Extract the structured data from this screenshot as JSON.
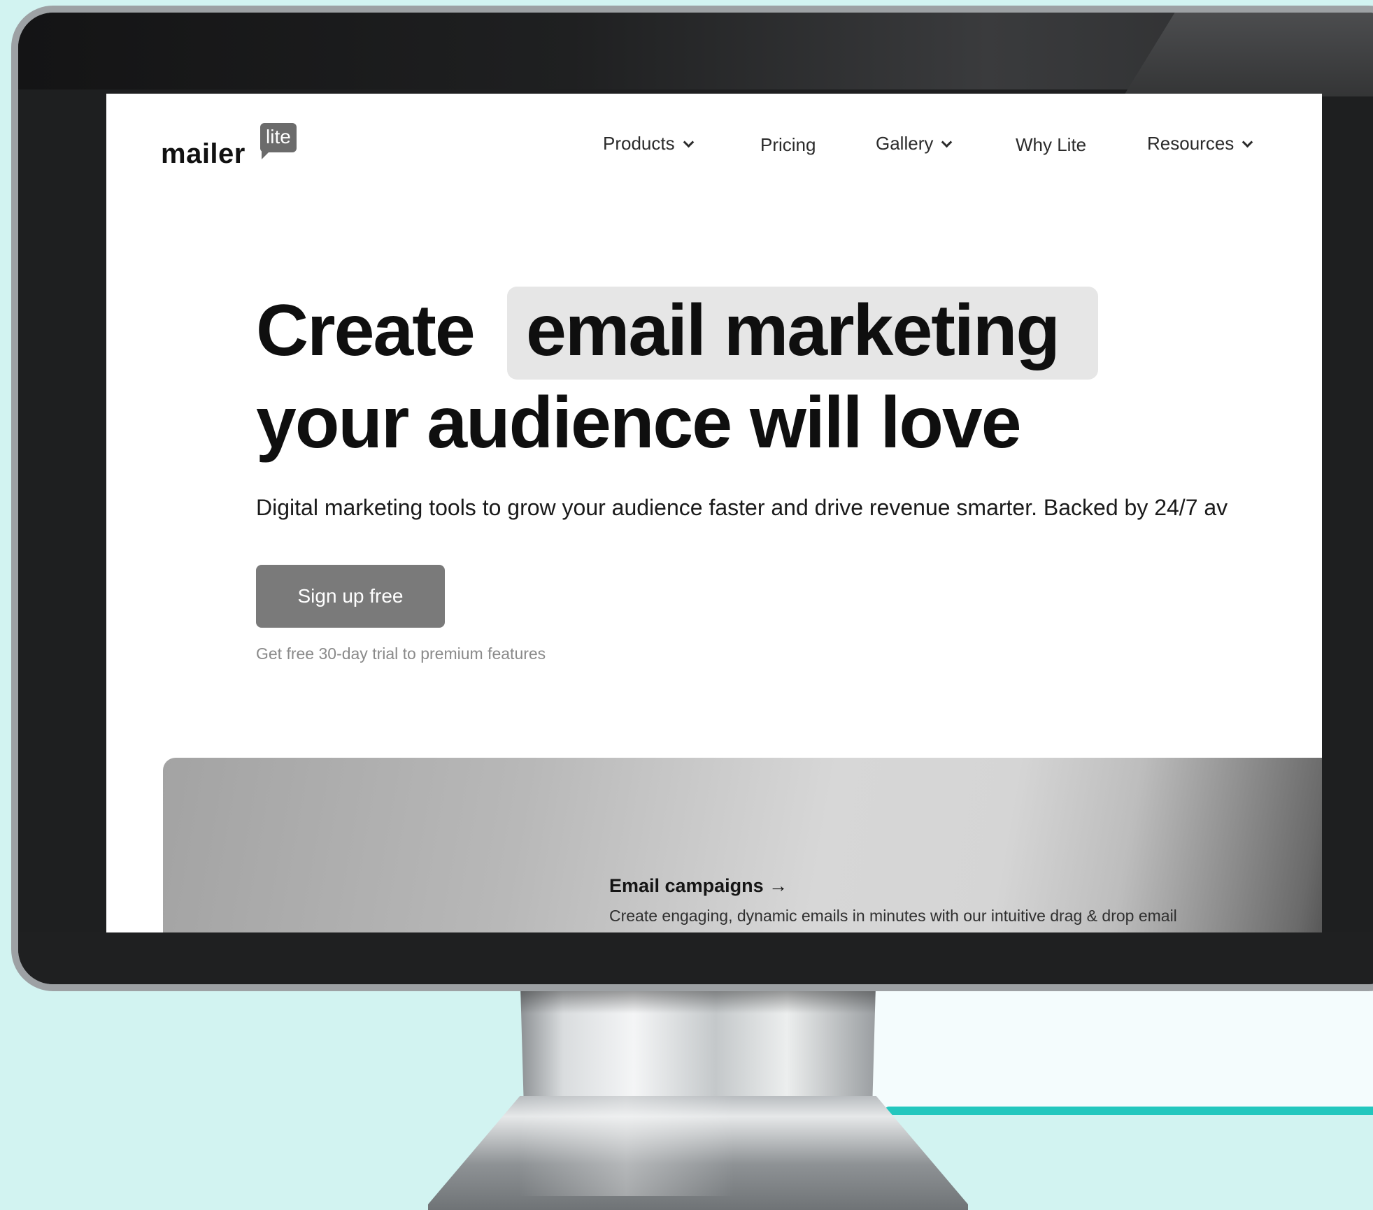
{
  "colors": {
    "background": "#d2f3f1",
    "accent_line": "#22c7be",
    "bezel": "#1e1f20",
    "button": "#7a7a7a",
    "highlight": "#e6e6e6"
  },
  "header": {
    "logo": {
      "word": "mailer",
      "badge": "lite"
    },
    "nav": [
      {
        "label": "Products",
        "dropdown": true
      },
      {
        "label": "Pricing",
        "dropdown": false
      },
      {
        "label": "Gallery",
        "dropdown": true
      },
      {
        "label": "Why Lite",
        "dropdown": false
      },
      {
        "label": "Resources",
        "dropdown": true
      }
    ]
  },
  "hero": {
    "title_part1": "Create",
    "title_highlight": "email marketing",
    "title_line2": "your audience will love",
    "subtitle": "Digital marketing tools to grow your audience faster and drive revenue smarter. Backed by 24/7 av",
    "cta_label": "Sign up free",
    "trial_note": "Get free 30-day trial to premium features"
  },
  "feature": {
    "title": "Email campaigns →",
    "description": "Create engaging, dynamic emails in minutes with our intuitive drag & drop email editor."
  }
}
